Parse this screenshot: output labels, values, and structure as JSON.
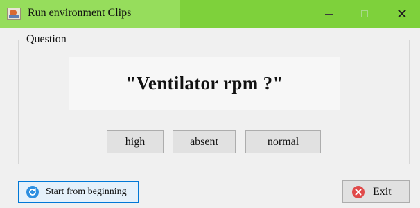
{
  "window": {
    "title": "Run environment Clips",
    "title_bar_color": "#7ed13b",
    "controls": [
      "minimize-icon",
      "maximize-icon",
      "close-icon"
    ]
  },
  "question_group": {
    "legend": "Question",
    "question": "\"Ventilator rpm ?\"",
    "answers": [
      {
        "label": "high"
      },
      {
        "label": "absent"
      },
      {
        "label": "normal"
      }
    ]
  },
  "footer": {
    "start_label": "Start from beginning",
    "start_icon": "refresh-icon",
    "exit_label": "Exit",
    "exit_icon": "exit-icon",
    "focus_color": "#0078d7"
  }
}
